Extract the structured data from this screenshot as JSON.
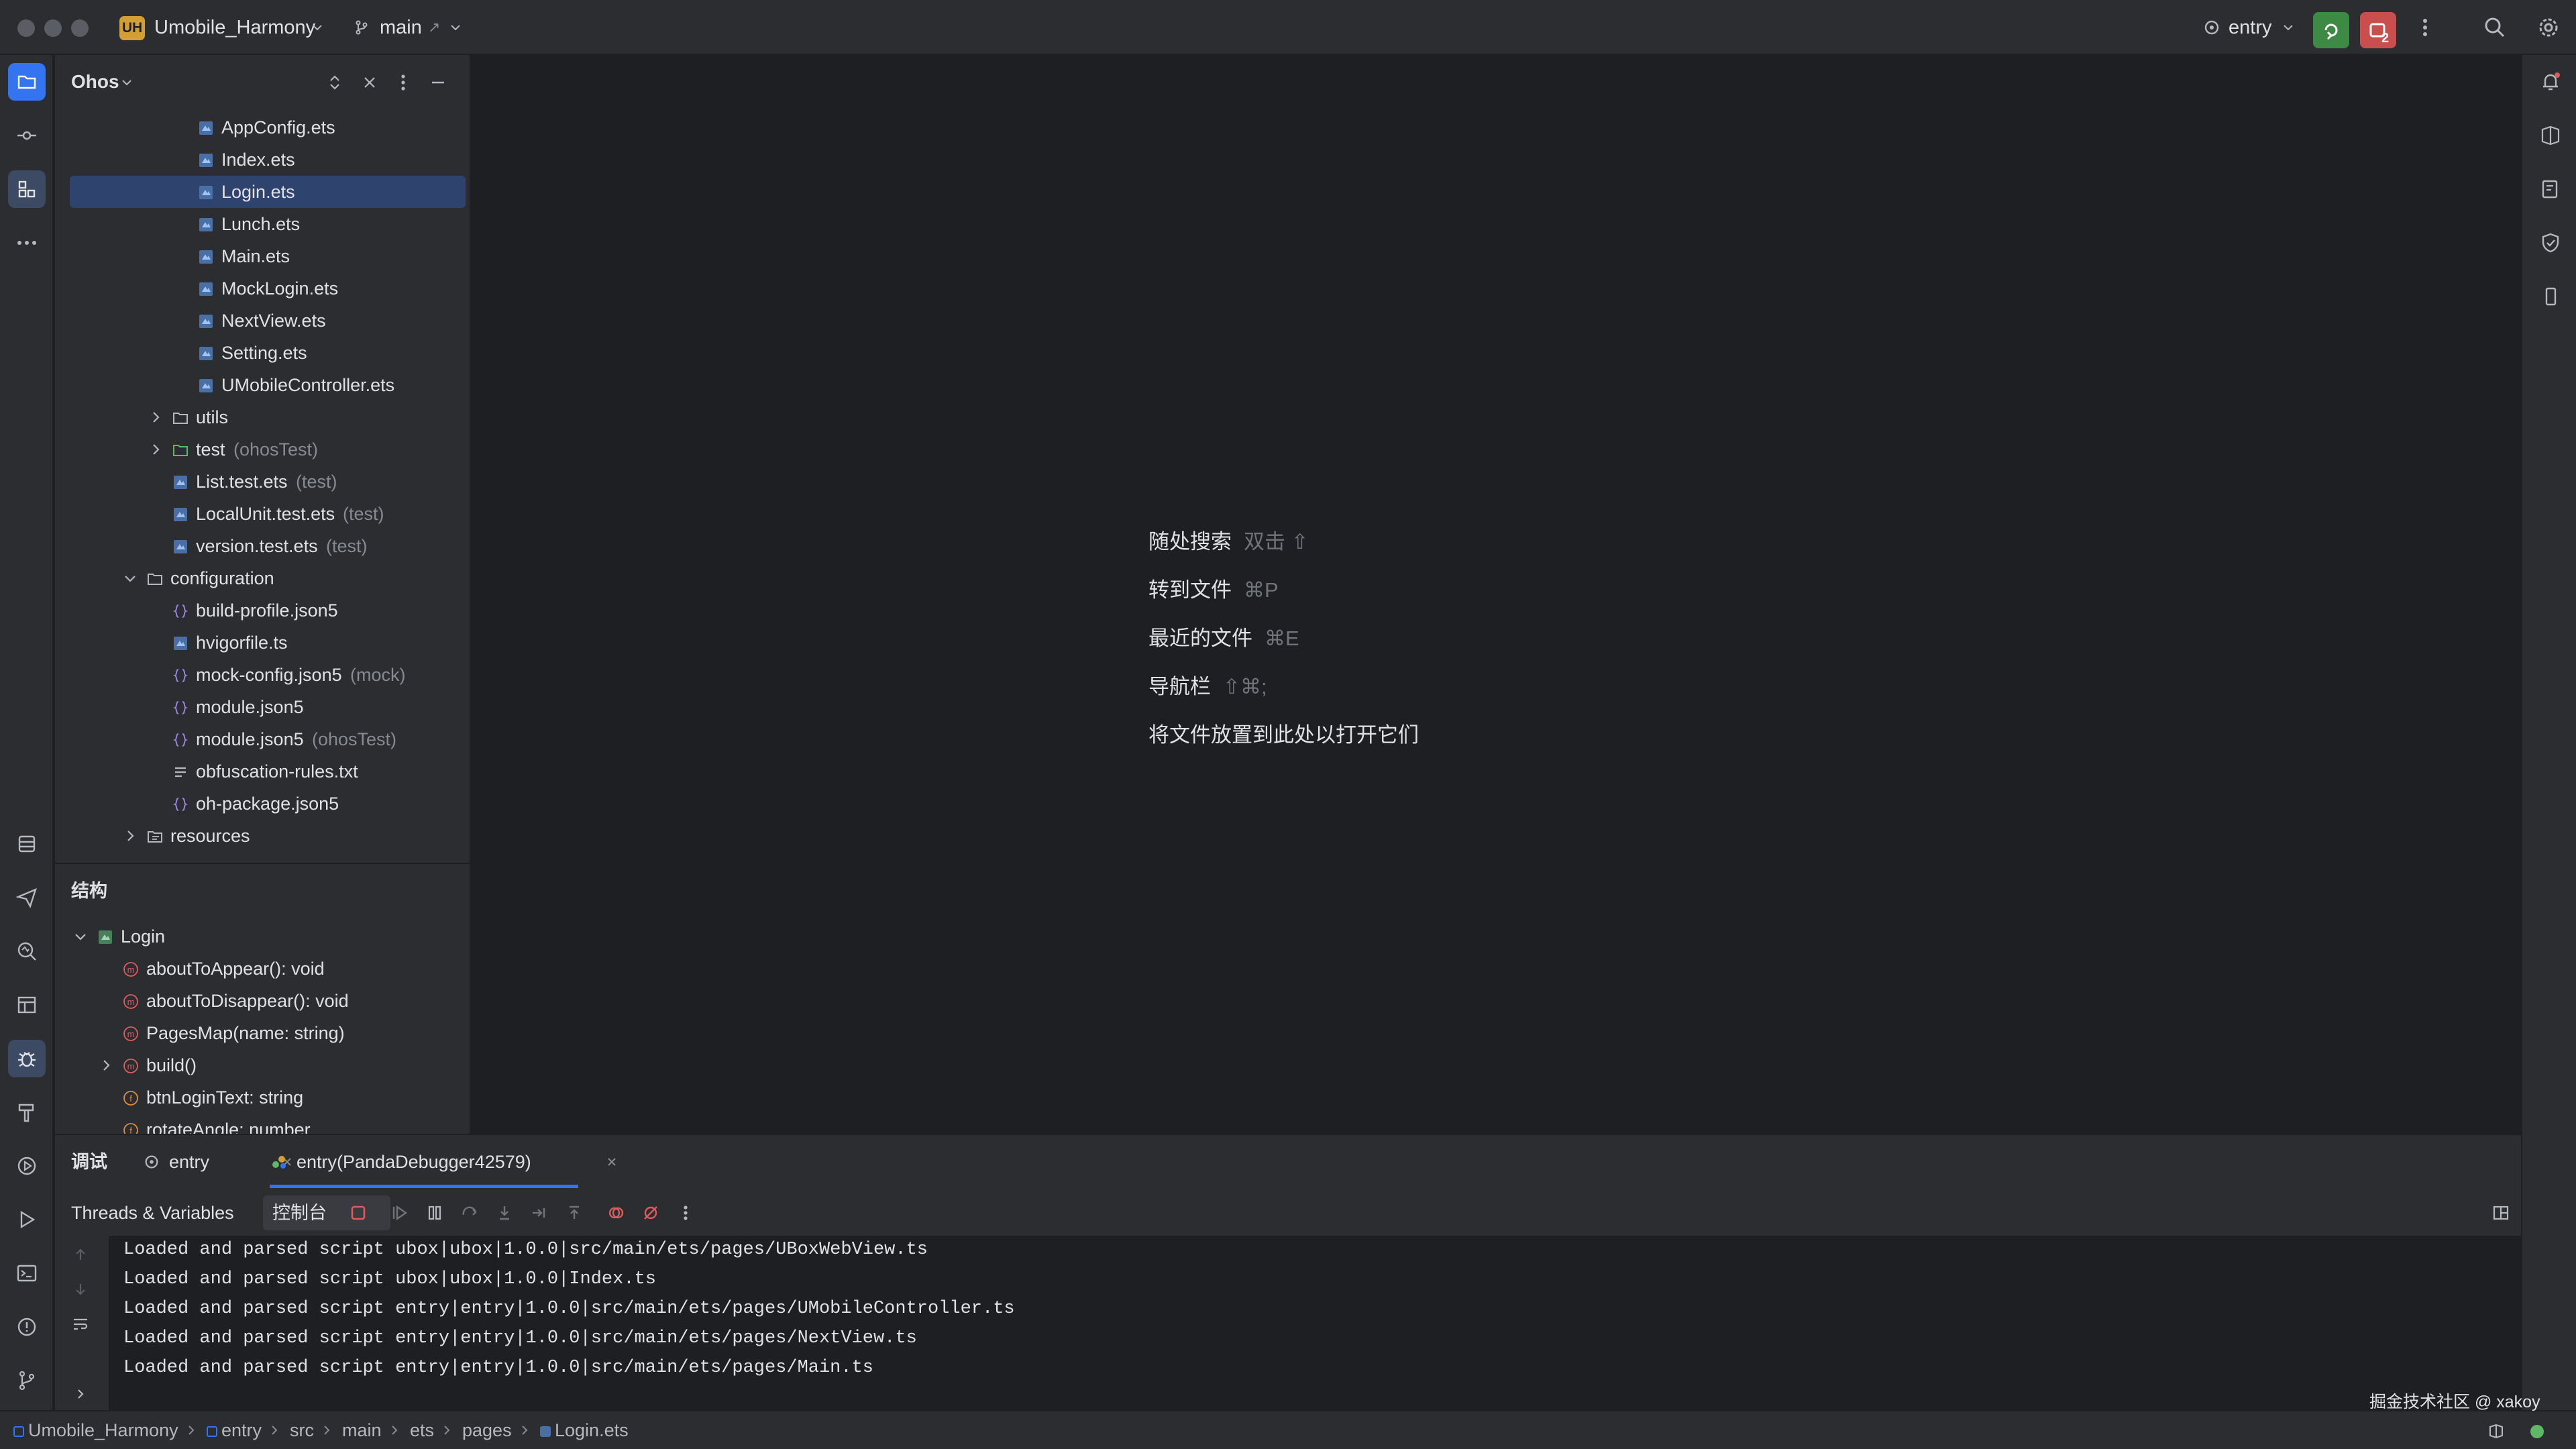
{
  "titlebar": {
    "project_badge": "UH",
    "project_name": "Umobile_Harmony",
    "branch": "main",
    "branch_arrow": "↗",
    "run_config": "entry",
    "badge_count": "2"
  },
  "project_panel": {
    "title": "Ohos",
    "tree": [
      {
        "label": "AppConfig.ets",
        "suffix": "",
        "icon": "ets-file-icon",
        "indent": 5
      },
      {
        "label": "Index.ets",
        "suffix": "",
        "icon": "ets-file-icon",
        "indent": 5
      },
      {
        "label": "Login.ets",
        "suffix": "",
        "icon": "ets-file-icon",
        "indent": 5,
        "selected": true
      },
      {
        "label": "Lunch.ets",
        "suffix": "",
        "icon": "ets-file-icon",
        "indent": 5
      },
      {
        "label": "Main.ets",
        "suffix": "",
        "icon": "ets-file-icon",
        "indent": 5
      },
      {
        "label": "MockLogin.ets",
        "suffix": "",
        "icon": "ets-file-icon",
        "indent": 5
      },
      {
        "label": "NextView.ets",
        "suffix": "",
        "icon": "ets-file-icon",
        "indent": 5
      },
      {
        "label": "Setting.ets",
        "suffix": "",
        "icon": "ets-file-icon",
        "indent": 5
      },
      {
        "label": "UMobileController.ets",
        "suffix": "",
        "icon": "ets-file-icon",
        "indent": 5
      },
      {
        "label": "utils",
        "suffix": "",
        "icon": "folder-icon",
        "indent": 4,
        "chevron": "right"
      },
      {
        "label": "test",
        "suffix": "(ohosTest)",
        "icon": "test-folder-icon",
        "indent": 4,
        "chevron": "right"
      },
      {
        "label": "List.test.ets",
        "suffix": "(test)",
        "icon": "ets-file-icon",
        "indent": 4
      },
      {
        "label": "LocalUnit.test.ets",
        "suffix": "(test)",
        "icon": "ets-file-icon",
        "indent": 4
      },
      {
        "label": "version.test.ets",
        "suffix": "(test)",
        "icon": "ets-file-icon",
        "indent": 4
      },
      {
        "label": "configuration",
        "suffix": "",
        "icon": "folder-icon",
        "indent": 3,
        "chevron": "down"
      },
      {
        "label": "build-profile.json5",
        "suffix": "",
        "icon": "json-file-icon",
        "indent": 4
      },
      {
        "label": "hvigorfile.ts",
        "suffix": "",
        "icon": "ets-file-icon",
        "indent": 4
      },
      {
        "label": "mock-config.json5",
        "suffix": "(mock)",
        "icon": "json-file-icon",
        "indent": 4
      },
      {
        "label": "module.json5",
        "suffix": "",
        "icon": "json-file-icon",
        "indent": 4
      },
      {
        "label": "module.json5",
        "suffix": "(ohosTest)",
        "icon": "json-file-icon",
        "indent": 4
      },
      {
        "label": "obfuscation-rules.txt",
        "suffix": "",
        "icon": "text-file-icon",
        "indent": 4
      },
      {
        "label": "oh-package.json5",
        "suffix": "",
        "icon": "json-file-icon",
        "indent": 4
      },
      {
        "label": "resources",
        "suffix": "",
        "icon": "resources-folder-icon",
        "indent": 3,
        "chevron": "right"
      }
    ]
  },
  "structure_panel": {
    "title": "结构",
    "items": [
      {
        "label": "Login",
        "kind": "class",
        "chevron": "down",
        "indent": 0
      },
      {
        "label": "aboutToAppear(): void",
        "kind": "m",
        "indent": 1
      },
      {
        "label": "aboutToDisappear(): void",
        "kind": "m",
        "indent": 1
      },
      {
        "label": "PagesMap(name: string)",
        "kind": "m",
        "indent": 1
      },
      {
        "label": "build()",
        "kind": "m",
        "chevron": "right",
        "indent": 1
      },
      {
        "label": "btnLoginText: string",
        "kind": "f",
        "indent": 1
      },
      {
        "label": "rotateAngle: number",
        "kind": "f",
        "indent": 1
      }
    ]
  },
  "editor": {
    "hints": [
      {
        "label": "随处搜索",
        "shortcut": "双击 ⇧"
      },
      {
        "label": "转到文件",
        "shortcut": "⌘P"
      },
      {
        "label": "最近的文件",
        "shortcut": "⌘E"
      },
      {
        "label": "导航栏",
        "shortcut": "⇧⌘;"
      },
      {
        "label": "将文件放置到此处以打开它们",
        "shortcut": ""
      }
    ]
  },
  "debug_panel": {
    "title": "调试",
    "tabs": [
      {
        "label": "entry",
        "active": false
      },
      {
        "label": "entry(PandaDebugger42579)",
        "active": true
      }
    ],
    "subtabs": [
      {
        "label": "Threads & Variables",
        "active": false
      },
      {
        "label": "控制台",
        "active": true
      }
    ],
    "console_lines": [
      "Loaded and parsed script ubox|ubox|1.0.0|src/main/ets/pages/UBoxWebView.ts",
      "Loaded and parsed script ubox|ubox|1.0.0|Index.ts",
      "Loaded and parsed script entry|entry|1.0.0|src/main/ets/pages/UMobileController.ts",
      "Loaded and parsed script entry|entry|1.0.0|src/main/ets/pages/NextView.ts",
      "Loaded and parsed script entry|entry|1.0.0|src/main/ets/pages/Main.ts"
    ]
  },
  "statusbar": {
    "breadcrumbs": [
      "Umobile_Harmony",
      "entry",
      "src",
      "main",
      "ets",
      "pages",
      "Login.ets"
    ],
    "watermark": "掘金技术社区 @ xakoy"
  },
  "colors": {
    "background": "#1e1f22",
    "panel": "#2b2d30",
    "selection": "#2e436e",
    "accent": "#3574f0",
    "green": "#5fb865",
    "red": "#db5c5c",
    "muted": "#868a91"
  }
}
